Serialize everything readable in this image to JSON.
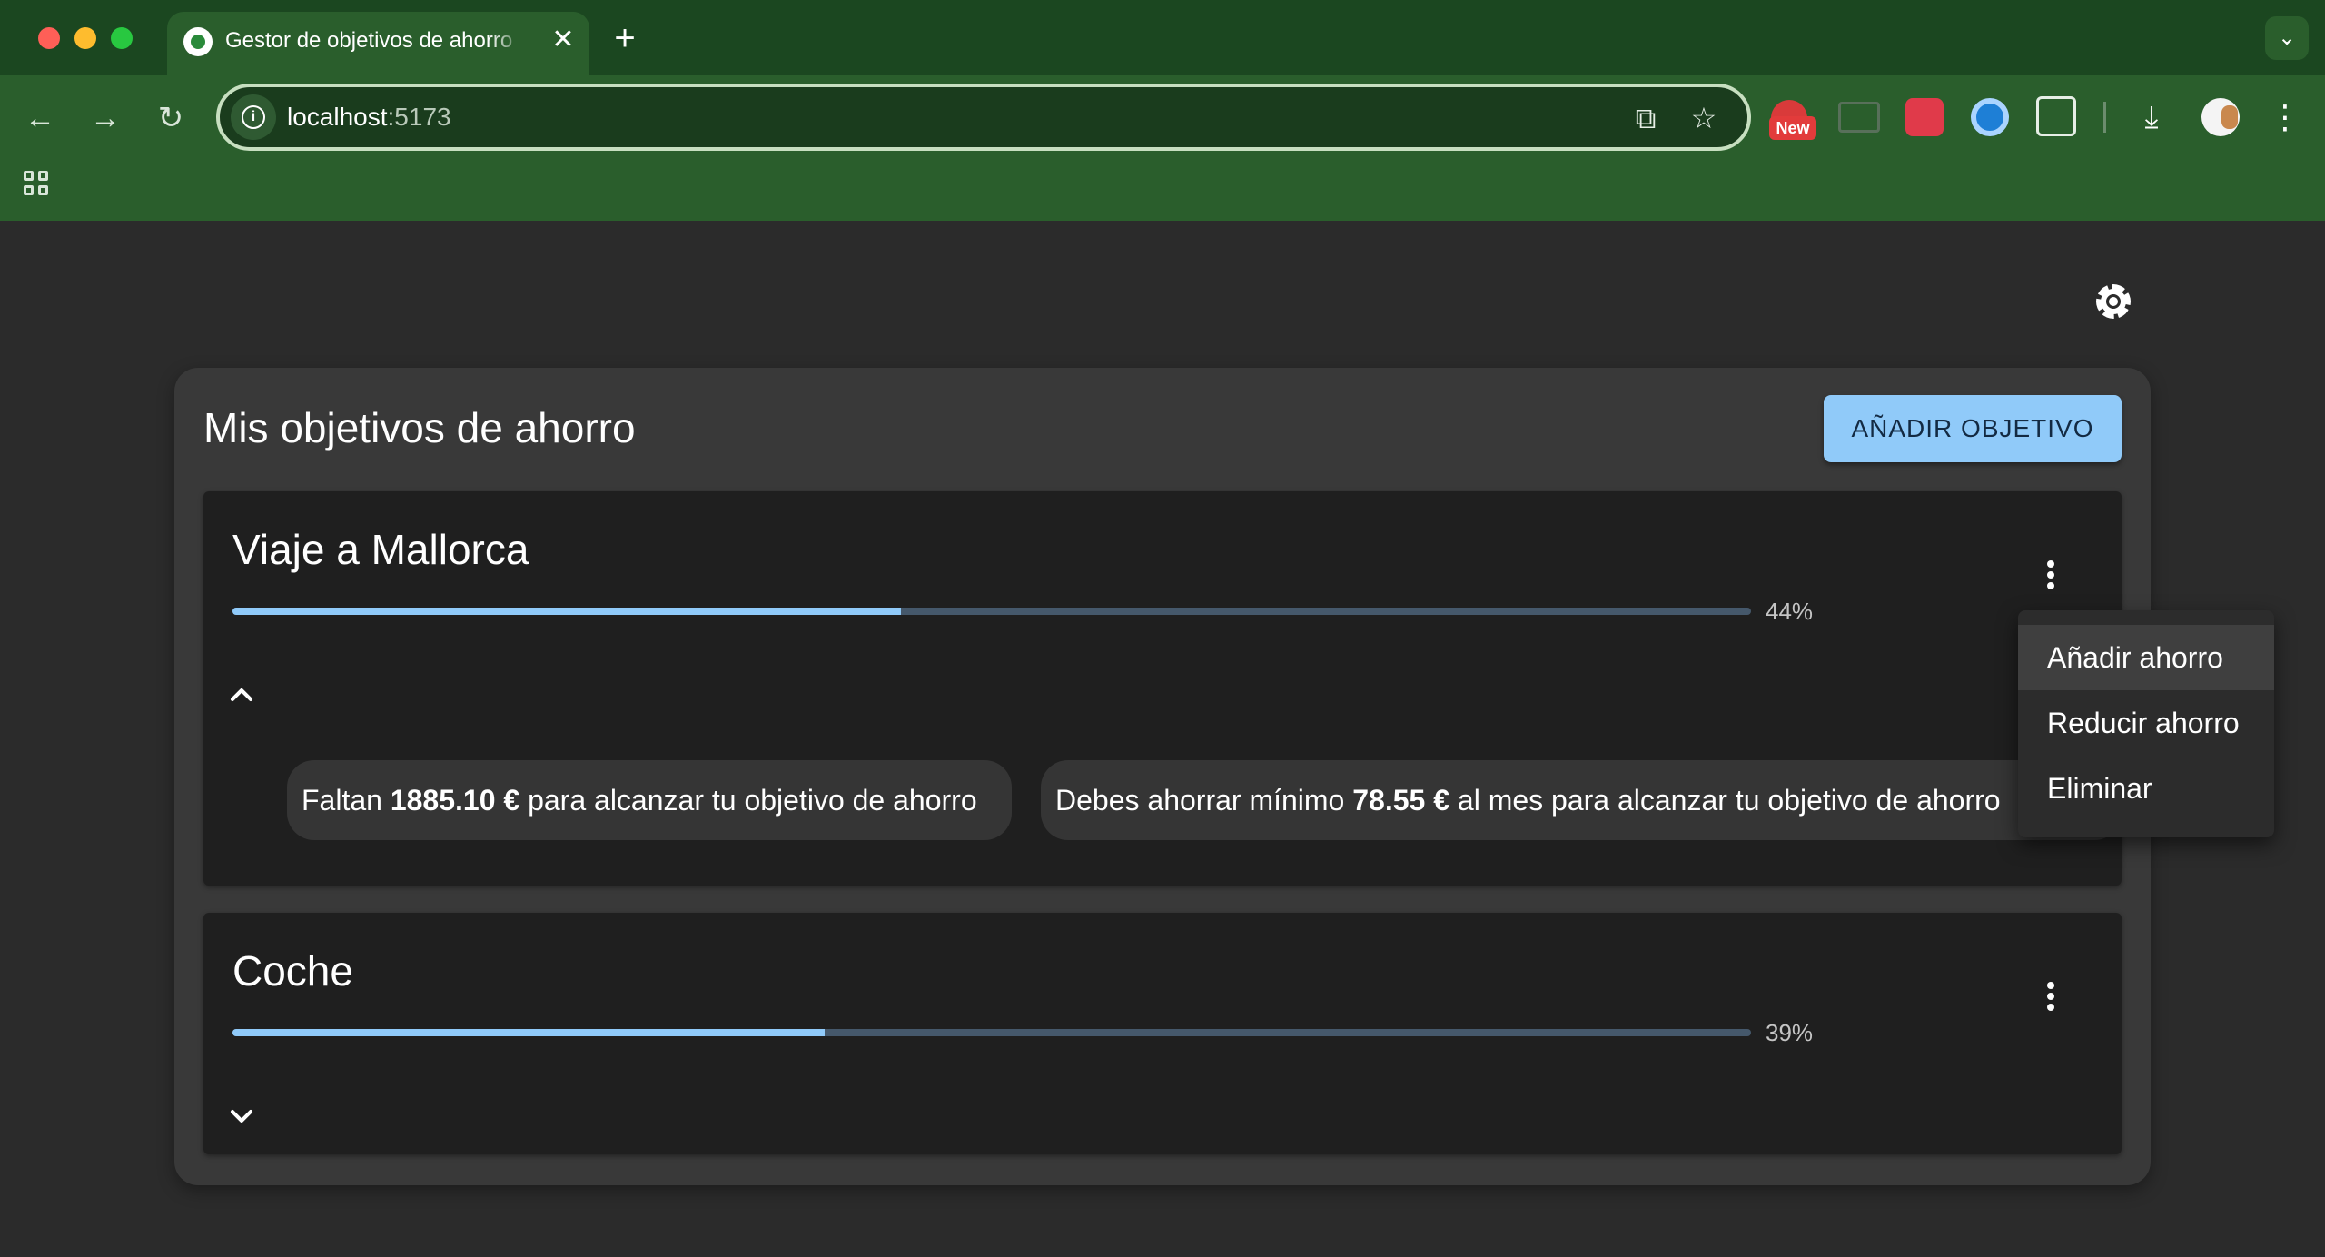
{
  "browser": {
    "tab_title": "Gestor de objetivos de ahorro",
    "tab_close": "✕",
    "new_tab": "+",
    "url_host": "localhost",
    "url_port": ":5173",
    "new_badge": "New",
    "icons": [
      "back-arrow-icon",
      "forward-arrow-icon",
      "reload-icon",
      "site-info-icon",
      "translate-icon",
      "star-icon",
      "download-icon",
      "kebab-menu-icon",
      "apps-grid-icon"
    ]
  },
  "app": {
    "title": "Mis objetivos de ahorro",
    "add_goal_label": "AÑADIR OBJETIVO",
    "goals": [
      {
        "name": "Viaje a Mallorca",
        "progress_percent": 44,
        "progress_label": "44%",
        "expanded": true,
        "chips": {
          "remaining_prefix": "Faltan ",
          "remaining_amount": "1885.10 €",
          "remaining_suffix": " para alcanzar tu objetivo de ahorro",
          "monthly_prefix": "Debes ahorrar mínimo ",
          "monthly_amount": "78.55 €",
          "monthly_suffix": " al mes para alcanzar tu objetivo de ahorro"
        }
      },
      {
        "name": "Coche",
        "progress_percent": 39,
        "progress_label": "39%",
        "expanded": false
      }
    ],
    "menu_items": [
      "Añadir ahorro",
      "Reducir ahorro",
      "Eliminar"
    ]
  },
  "colors": {
    "accent": "#90caf9",
    "page_bg": "#2b2b2b",
    "panel_bg": "#393939",
    "card_bg": "#1f1f1f",
    "chrome_bg": "#2a5e2c"
  }
}
